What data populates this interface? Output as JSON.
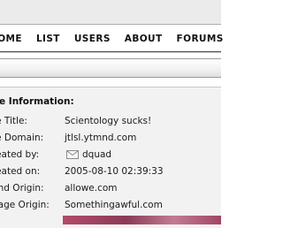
{
  "nav": {
    "items": [
      {
        "name": "nav-home",
        "label": "HOME"
      },
      {
        "name": "nav-list",
        "label": "LIST"
      },
      {
        "name": "nav-users",
        "label": "USERS"
      },
      {
        "name": "nav-about",
        "label": "ABOUT"
      },
      {
        "name": "nav-forums",
        "label": "FORUMS"
      }
    ]
  },
  "info": {
    "heading": "te Information:",
    "rows": [
      {
        "label": "te Title:",
        "value": "Scientology sucks!"
      },
      {
        "label": "te Domain:",
        "value": "jtlsl.ytmnd.com"
      },
      {
        "label": "reated by:",
        "value": "dquad",
        "icon": "envelope-icon"
      },
      {
        "label": "reated on:",
        "value": "2005-08-10 02:39:33"
      },
      {
        "label": "und Origin:",
        "value": "allowe.com"
      },
      {
        "label": "nage Origin:",
        "value": "Somethingawful.com"
      }
    ]
  },
  "colors": {
    "topbar": "#ebebeb",
    "panel": "#f2f2f2",
    "text": "#111111",
    "thumbnail": "#a34565"
  }
}
